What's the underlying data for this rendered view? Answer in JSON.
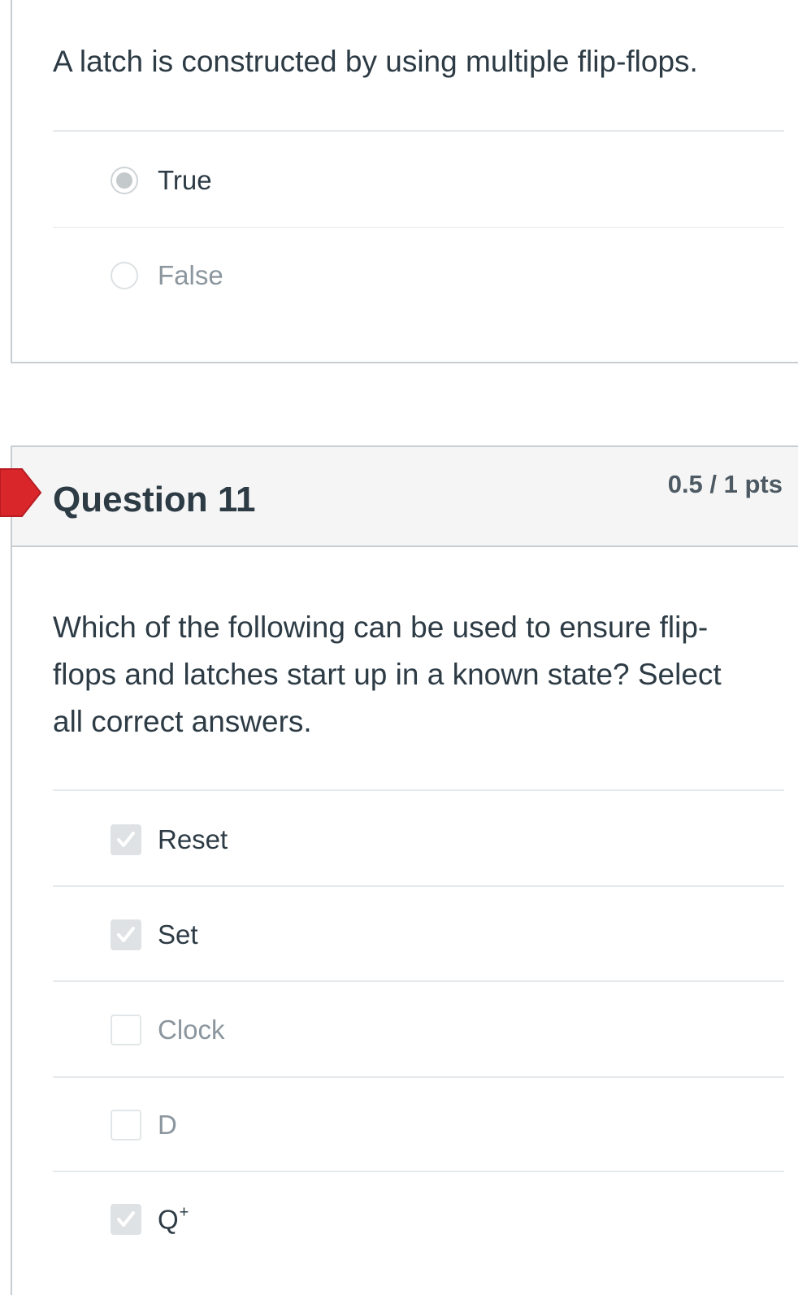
{
  "question10": {
    "text": "A latch is constructed by using multiple flip-flops.",
    "answers": [
      {
        "label": "True",
        "selected": true
      },
      {
        "label": "False",
        "selected": false
      }
    ]
  },
  "question11": {
    "title": "Question 11",
    "points": "0.5 / 1 pts",
    "text": "Which of the following can be used to ensure flip-flops and latches start up in a known state? Select all correct answers.",
    "answers": [
      {
        "label": "Reset",
        "checked": true
      },
      {
        "label": "Set",
        "checked": true
      },
      {
        "label": "Clock",
        "checked": false
      },
      {
        "label": "D",
        "checked": false
      },
      {
        "label": "Q",
        "superscript": "+",
        "checked": true
      }
    ]
  },
  "colors": {
    "flag": "#d9262b",
    "text": "#2d3b45",
    "muted_text": "#8b969e",
    "header_bg": "#f5f5f5",
    "border": "#c7cdd1"
  },
  "icons": {
    "flag": "incorrect-flag-icon",
    "radio": "radio-button",
    "checkbox": "checkbox"
  }
}
